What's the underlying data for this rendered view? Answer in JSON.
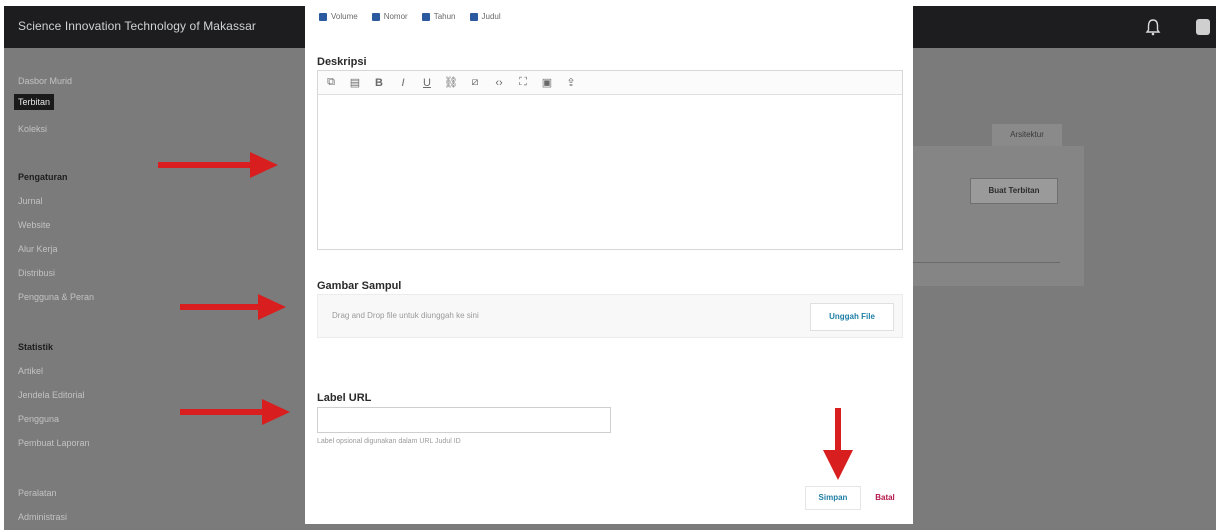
{
  "app": {
    "title": "Science Innovation Technology of Makassar"
  },
  "sidebar": {
    "items": [
      {
        "label": "Dasbor Murid"
      },
      {
        "label": "Terbitan"
      },
      {
        "label": "Koleksi"
      }
    ],
    "section1": {
      "title": "Pengaturan",
      "items": [
        "Jurnal",
        "Website",
        "Alur Kerja",
        "Distribusi",
        "Pengguna & Peran"
      ]
    },
    "section2": {
      "title": "Statistik",
      "items": [
        "Artikel",
        "Jendela Editorial",
        "Pengguna",
        "Pembuat Laporan"
      ]
    },
    "section3": {
      "items": [
        "Peralatan",
        "Administrasi"
      ]
    }
  },
  "background": {
    "tab_label": "Arsitektur",
    "button_label": "Buat Terbitan"
  },
  "modal": {
    "columns": [
      "Volume",
      "Nomor",
      "Tahun",
      "Judul"
    ],
    "description_label": "Deskripsi",
    "toolbar_icons": [
      "copy-icon",
      "paste-icon",
      "bold-icon",
      "italic-icon",
      "underline-icon",
      "link-icon",
      "unlink-icon",
      "code-icon",
      "fullscreen-icon",
      "image-icon",
      "upload-icon"
    ],
    "toolbar_glyphs": [
      "⧉",
      "▤",
      "B",
      "I",
      "U",
      "⛓",
      "⧄",
      "‹›",
      "⛶",
      "▣",
      "⇪"
    ],
    "cover_label": "Gambar Sampul",
    "dropzone_text": "Drag and Drop file untuk diunggah ke sini",
    "upload_button": "Unggah File",
    "url_label": "Label URL",
    "url_value": "",
    "url_hint": "Label opsional digunakan dalam URL Judul ID",
    "save_button": "Simpan",
    "cancel_button": "Batal"
  },
  "colors": {
    "accent": "#1e7ea6",
    "danger": "#b5174a",
    "arrow": "#d81e1e"
  }
}
